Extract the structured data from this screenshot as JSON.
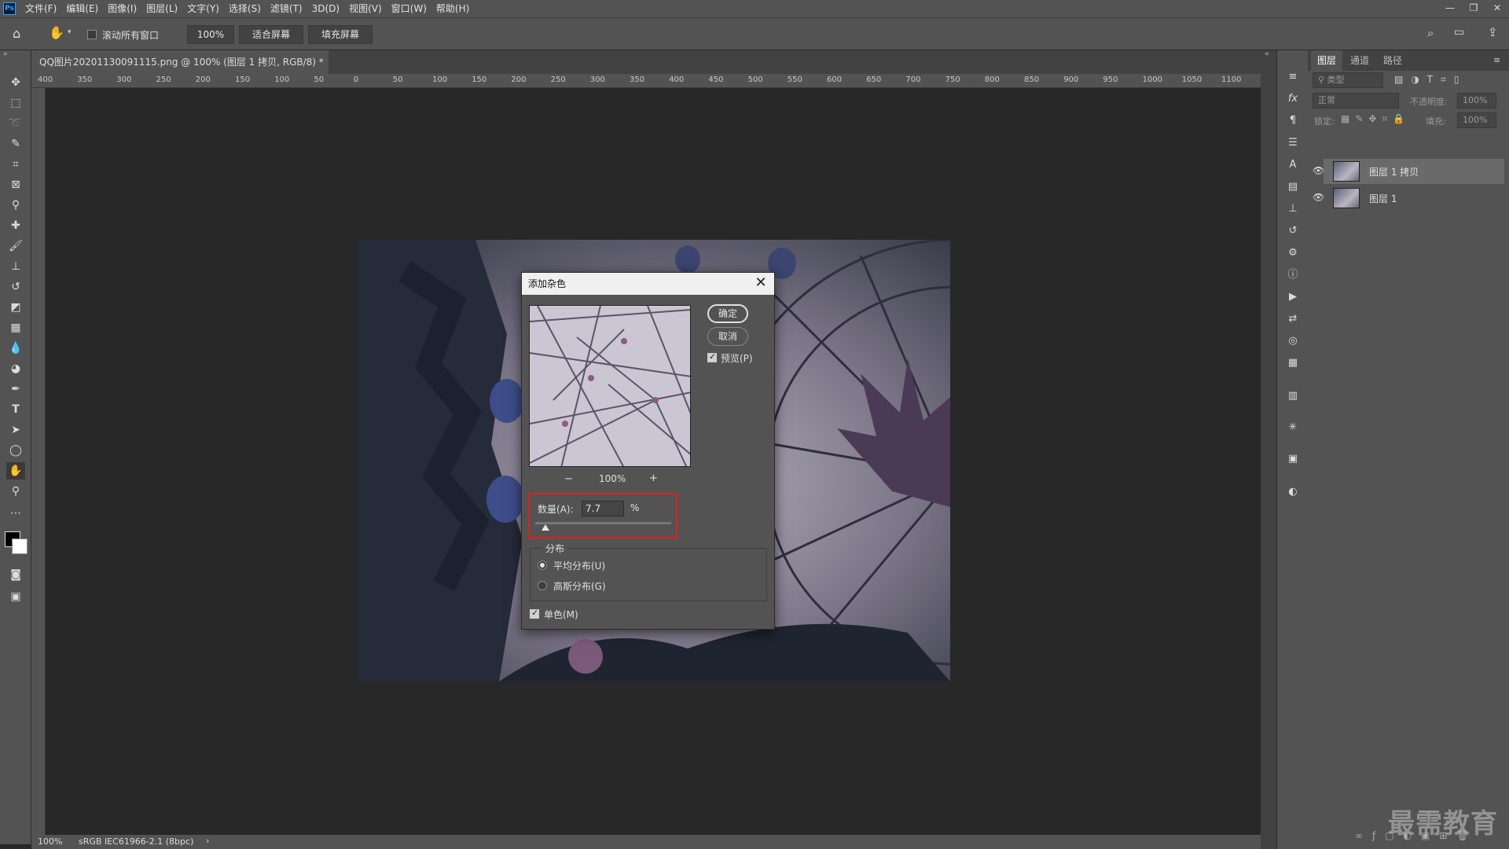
{
  "app": {
    "logo": "Ps"
  },
  "menu": [
    "文件(F)",
    "编辑(E)",
    "图像(I)",
    "图层(L)",
    "文字(Y)",
    "选择(S)",
    "滤镜(T)",
    "3D(D)",
    "视图(V)",
    "窗口(W)",
    "帮助(H)"
  ],
  "window_controls": [
    "—",
    "❐",
    "✕"
  ],
  "options_bar": {
    "scroll_all_label": "滚动所有窗口",
    "scroll_all_checked": false,
    "zoom_value": "100%",
    "fit_screen": "适合屏幕",
    "fill_screen": "填充屏幕"
  },
  "document": {
    "tab_title": "QQ图片20201130091115.png @ 100% (图层 1 拷贝, RGB/8) *",
    "tab_close": "×"
  },
  "ruler_h": [
    "400",
    "350",
    "300",
    "250",
    "200",
    "150",
    "100",
    "50",
    "0",
    "50",
    "100",
    "150",
    "200",
    "250",
    "300",
    "350",
    "400",
    "450",
    "500",
    "550",
    "600",
    "650",
    "700",
    "750",
    "800",
    "850",
    "900",
    "950",
    "1000",
    "1050",
    "1100"
  ],
  "status": {
    "zoom": "100%",
    "profile": "sRGB IEC61966-2.1 (8bpc)",
    "arrow": "›"
  },
  "layers_panel": {
    "tabs": [
      "图层",
      "通道",
      "路径"
    ],
    "active_tab": 0,
    "filter_placeholder": "类型",
    "blend_mode": "正常",
    "opacity_label": "不透明度:",
    "opacity_value": "100%",
    "lock_label": "锁定:",
    "fill_label": "填充:",
    "fill_value": "100%",
    "layers": [
      {
        "name": "图层 1 拷贝",
        "visible": true,
        "selected": true
      },
      {
        "name": "图层 1",
        "visible": true,
        "selected": false
      }
    ]
  },
  "dialog": {
    "title": "添加杂色",
    "close": "✕",
    "ok_label": "确定",
    "cancel_label": "取消",
    "preview_label": "预览(P)",
    "preview_checked": true,
    "zoom_out": "−",
    "zoom_level": "100%",
    "zoom_in": "+",
    "amount_label": "数量(A):",
    "amount_value": "7.7",
    "amount_unit": "%",
    "amount_slider_fraction": 0.077,
    "distribution_title": "分布",
    "uniform_label": "平均分布(U)",
    "gaussian_label": "高斯分布(G)",
    "selected_distribution": "uniform",
    "monochromatic_label": "单色(M)",
    "monochromatic_checked": true
  },
  "watermark": "最需教育",
  "colors": {
    "highlight": "#e02020",
    "panel": "#535353",
    "canvas": "#282828"
  }
}
